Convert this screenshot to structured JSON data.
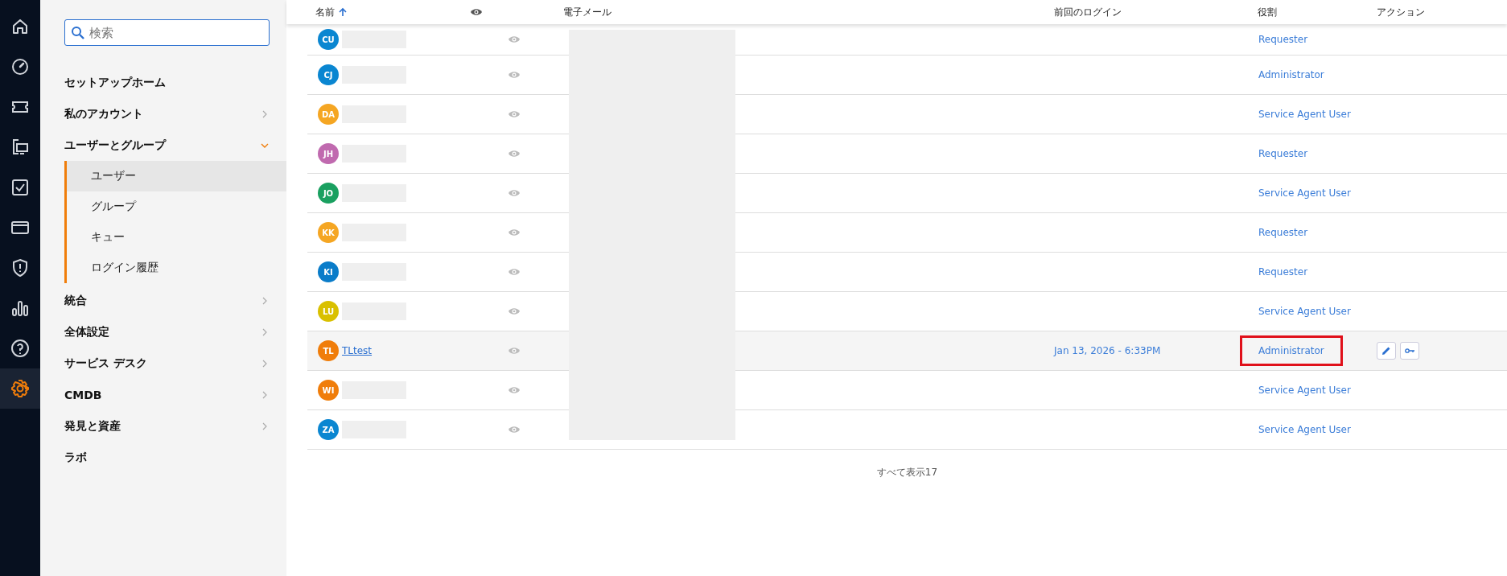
{
  "nav_rail": [
    {
      "selected": false
    },
    {
      "selected": false
    },
    {
      "selected": false
    },
    {
      "selected": false
    },
    {
      "selected": false
    },
    {
      "selected": false
    },
    {
      "selected": false
    },
    {
      "selected": false
    },
    {
      "selected": false
    },
    {
      "selected": true
    }
  ],
  "sidebar": {
    "search": {
      "placeholder": "検索"
    },
    "items": [
      {
        "label": "セットアップホーム",
        "has_children": false
      },
      {
        "label": "私のアカウント",
        "has_children": true,
        "expanded": false
      },
      {
        "label": "ユーザーとグループ",
        "has_children": true,
        "expanded": true,
        "children": [
          {
            "label": "ユーザー",
            "selected": true
          },
          {
            "label": "グループ",
            "selected": false
          },
          {
            "label": "キュー",
            "selected": false
          },
          {
            "label": "ログイン履歴",
            "selected": false
          }
        ]
      },
      {
        "label": "統合",
        "has_children": true,
        "expanded": false
      },
      {
        "label": "全体設定",
        "has_children": true,
        "expanded": false
      },
      {
        "label": "サービス デスク",
        "has_children": true,
        "expanded": false
      },
      {
        "label": "CMDB",
        "has_children": true,
        "expanded": false
      },
      {
        "label": "発見と資産",
        "has_children": true,
        "expanded": false
      },
      {
        "label": "ラボ",
        "has_children": false
      }
    ]
  },
  "table": {
    "columns": [
      {
        "kind": "text",
        "label": "名前",
        "sorted": true
      },
      {
        "kind": "eye"
      },
      {
        "kind": "text",
        "label": "電子メール"
      },
      {
        "kind": "text",
        "label": "前回のログイン"
      },
      {
        "kind": "text",
        "label": "役割"
      },
      {
        "kind": "text",
        "label": "アクション"
      }
    ],
    "rows": [
      {
        "initials": "CU",
        "color": "#0a86d1",
        "name_redacted": true,
        "role": "Requester",
        "hovered": false,
        "role_outlined": false
      },
      {
        "initials": "CJ",
        "color": "#0a86d1",
        "name_redacted": true,
        "role": "Administrator",
        "hovered": false,
        "role_outlined": false
      },
      {
        "initials": "DA",
        "color": "#f5a623",
        "name_redacted": true,
        "role": "Service Agent User",
        "hovered": false,
        "role_outlined": false
      },
      {
        "initials": "JH",
        "color": "#c06aaf",
        "name_redacted": true,
        "role": "Requester",
        "hovered": false,
        "role_outlined": false
      },
      {
        "initials": "JO",
        "color": "#1aa060",
        "name_redacted": true,
        "role": "Service Agent User",
        "hovered": false,
        "role_outlined": false
      },
      {
        "initials": "KK",
        "color": "#f5a623",
        "name_redacted": true,
        "role": "Requester",
        "hovered": false,
        "role_outlined": false
      },
      {
        "initials": "KI",
        "color": "#0a7cc9",
        "name_redacted": true,
        "role": "Requester",
        "hovered": false,
        "role_outlined": false
      },
      {
        "initials": "LU",
        "color": "#d9c000",
        "name_redacted": true,
        "role": "Service Agent User",
        "hovered": false,
        "role_outlined": false
      },
      {
        "initials": "TL",
        "color": "#f07d0a",
        "name": "TLtest",
        "name_redacted": false,
        "last_login": "Jan 13, 2026 - 6:33PM",
        "role": "Administrator",
        "hovered": true,
        "role_outlined": true
      },
      {
        "initials": "WI",
        "color": "#f07d0a",
        "name_redacted": true,
        "role": "Service Agent User",
        "hovered": false,
        "role_outlined": false
      },
      {
        "initials": "ZA",
        "color": "#0a86d1",
        "name_redacted": true,
        "role": "Service Agent User",
        "hovered": false,
        "role_outlined": false
      }
    ],
    "email_redacted": true,
    "footer": "すべて表示17"
  }
}
